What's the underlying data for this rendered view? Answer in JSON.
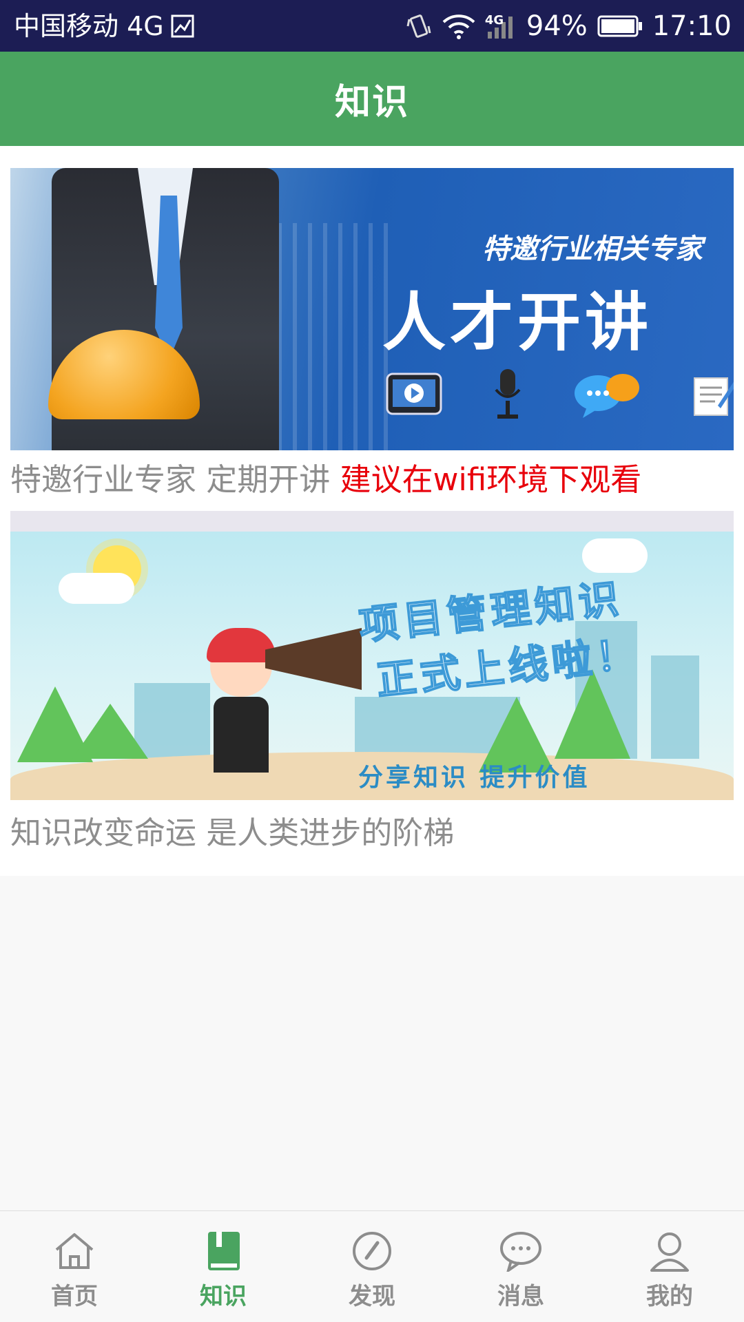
{
  "status_bar": {
    "carrier": "中国移动 4G",
    "network_badge": "4G",
    "battery": "94%",
    "time": "17:10"
  },
  "appbar": {
    "title": "知识"
  },
  "cards": [
    {
      "banner_small": "特邀行业相关专家",
      "banner_big": "人才开讲",
      "caption": "特邀行业专家 定期开讲",
      "caption_highlight": "建议在wifi环境下观看",
      "highlight_color": "#e8000b"
    },
    {
      "banner_line1": "项目管理知识",
      "banner_line2": "正式上线啦！",
      "banner_footer": "分享知识 提升价值",
      "caption": "知识改变命运 是人类进步的阶梯"
    }
  ],
  "tabs": [
    {
      "label": "首页",
      "icon": "home-icon",
      "active": false
    },
    {
      "label": "知识",
      "icon": "book-icon",
      "active": true
    },
    {
      "label": "发现",
      "icon": "compass-icon",
      "active": false
    },
    {
      "label": "消息",
      "icon": "chat-icon",
      "active": false
    },
    {
      "label": "我的",
      "icon": "user-icon",
      "active": false
    }
  ],
  "colors": {
    "accent": "#4aa460",
    "statusbar": "#1c1d54",
    "caption": "#8d8d8d"
  }
}
